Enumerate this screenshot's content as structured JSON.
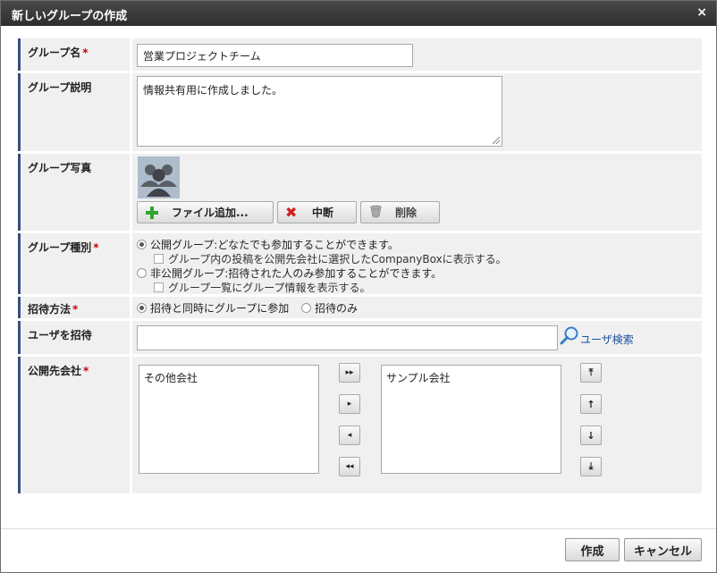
{
  "dialog": {
    "title": "新しいグループの作成",
    "close_glyph": "×"
  },
  "form": {
    "required_mark": "*",
    "group_name": {
      "label": "グループ名",
      "value": "営業プロジェクトチーム"
    },
    "group_description": {
      "label": "グループ説明",
      "value": "情報共有用に作成しました。"
    },
    "group_photo": {
      "label": "グループ写真",
      "add_file_label": "ファイル追加...",
      "cancel_label": "中断",
      "delete_label": "削除"
    },
    "group_type": {
      "label": "グループ種別",
      "public_option": "公開グループ:どなたでも参加することができます。",
      "public_sub_option": "グループ内の投稿を公開先会社に選択したCompanyBoxに表示する。",
      "private_option": "非公開グループ:招待された人のみ参加することができます。",
      "private_sub_option": "グループ一覧にグループ情報を表示する。",
      "selected": "public"
    },
    "invite_method": {
      "label": "招待方法",
      "option_join": "招待と同時にグループに参加",
      "option_invite_only": "招待のみ",
      "selected": "join"
    },
    "invite_users": {
      "label": "ユーザを招待",
      "value": "",
      "search_link": "ユーザ検索"
    },
    "public_companies": {
      "label": "公開先会社",
      "available": [
        "その他会社"
      ],
      "selected": [
        "サンプル会社"
      ],
      "move_all_right": "▸▸",
      "move_right": "▸",
      "move_left": "◂",
      "move_all_left": "◂◂",
      "move_top": "⤒",
      "move_up": "↑",
      "move_down": "↓",
      "move_bottom": "⤓"
    }
  },
  "footer": {
    "create_label": "作成",
    "cancel_label": "キャンセル"
  }
}
